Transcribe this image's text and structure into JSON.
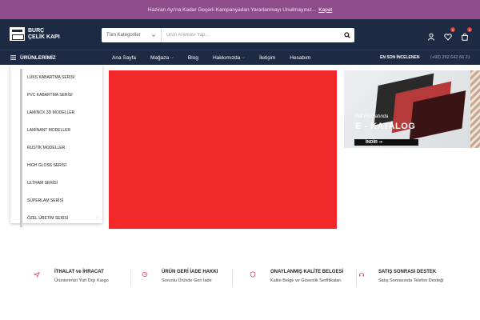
{
  "announcement": {
    "text": "Haziran Ayı'na Kadar Geçerli Kampanyadan Yararlanmayı Unutmayınız...",
    "close_label": "Kapat"
  },
  "header": {
    "logo_line1": "BURÇ",
    "logo_line2": "ÇELİK KAPI",
    "search": {
      "category_label": "Tüm Kategoriler",
      "placeholder": "Ürün Araması Yap..."
    },
    "wishlist_count": "0",
    "cart_count": "0"
  },
  "nav": {
    "categories_label": "ÜRÜNLERİMİZ",
    "links": [
      {
        "label": "Ana Sayfa",
        "has_dropdown": false
      },
      {
        "label": "Mağaza",
        "has_dropdown": true
      },
      {
        "label": "Blog",
        "has_dropdown": false
      },
      {
        "label": "Hakkımızda",
        "has_dropdown": true
      },
      {
        "label": "İletişim",
        "has_dropdown": false
      },
      {
        "label": "Hesabım",
        "has_dropdown": false
      }
    ],
    "recent_label": "EN SON İNCELENEN",
    "phone": "(+90) 262 642 66 21"
  },
  "categories": [
    {
      "label": "LÜKS KABARTMA SERİSİ",
      "has_sub": false
    },
    {
      "label": "PVC KABARTMA SERİSİ",
      "has_sub": false
    },
    {
      "label": "LAMINOX 3D MODELLER",
      "has_sub": false
    },
    {
      "label": "LAMİNANT MODELLER",
      "has_sub": false
    },
    {
      "label": "RUSTİK MODELLER",
      "has_sub": false
    },
    {
      "label": "HIGH GLOSS SERİSİ",
      "has_sub": false
    },
    {
      "label": "ULTRAM SERİSİ",
      "has_sub": false
    },
    {
      "label": "SÜPERLAM SERİSİ",
      "has_sub": false
    },
    {
      "label": "ÖZEL ÜRETİM SERİSİ",
      "has_sub": true
    }
  ],
  "hero": {
    "color": "#f3282b"
  },
  "catalog_banner": {
    "small_text": "Pdf Formatında",
    "big_text": "E - KATALOG",
    "button_label": "İNDİR ➞"
  },
  "features": [
    {
      "title": "İTHALAT ve İHRACAT",
      "subtitle": "Ürünlerimizi Yurt Dışı Kargo",
      "icon": "plane-icon"
    },
    {
      "title": "ÜRÜN GERİ İADE HAKKI",
      "subtitle": "Sorunlu Üründe Geri İade",
      "icon": "return-icon"
    },
    {
      "title": "ONAYLANMIŞ KALİTE BELGESİ",
      "subtitle": "Kalite Belge ve Güvenlik Serfitikaları",
      "icon": "certificate-icon"
    },
    {
      "title": "SATIŞ SONRASI DESTEK",
      "subtitle": "Satış Sonrasında Telefon Desteği",
      "icon": "support-icon"
    }
  ],
  "colors": {
    "header_bg": "#1d2a44",
    "announce_bg": "#8e4d8a",
    "accent": "#e23b3b"
  }
}
